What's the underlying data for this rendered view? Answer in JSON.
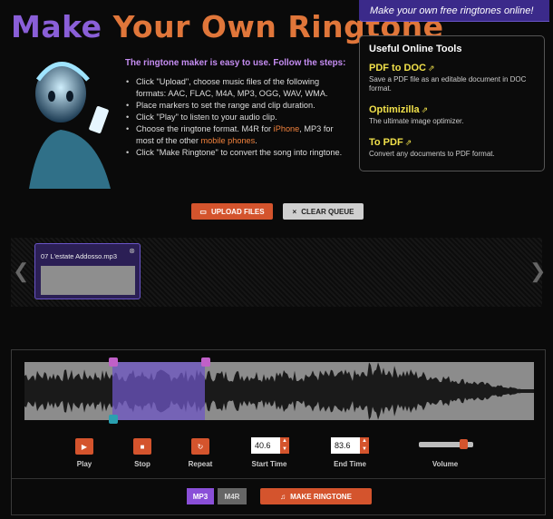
{
  "header": {
    "title_part1": "Make",
    "title_part2": "Your Own Ringtone",
    "banner": "Make your own free ringtones online!"
  },
  "intro": {
    "heading": "The ringtone maker is easy to use. Follow the steps:",
    "steps": [
      {
        "text": "Click \"Upload\", choose music files of the following formats: AAC, FLAC, M4A, MP3, OGG, WAV, WMA."
      },
      {
        "text": "Place markers to set the range and clip duration."
      },
      {
        "text": "Click \"Play\" to listen to your audio clip."
      },
      {
        "pre": "Choose the ringtone format. M4R for ",
        "hl1": "iPhone",
        "mid": ", MP3 for most of the other ",
        "hl2": "mobile phones",
        "post": "."
      },
      {
        "text": "Click \"Make Ringtone\" to convert the song into ringtone."
      }
    ]
  },
  "tools": {
    "heading": "Useful Online Tools",
    "items": [
      {
        "name": "PDF to DOC",
        "desc": "Save a PDF file as an editable document in DOC format."
      },
      {
        "name": "Optimizilla",
        "desc": "The ultimate image optimizer."
      },
      {
        "name": "To PDF",
        "desc": "Convert any documents to PDF format."
      }
    ]
  },
  "actions": {
    "upload": "UPLOAD FILES",
    "clear": "CLEAR QUEUE"
  },
  "queue": {
    "files": [
      {
        "name": "07 L'estate Addosso.mp3"
      }
    ]
  },
  "player": {
    "play": "Play",
    "stop": "Stop",
    "repeat": "Repeat",
    "start_label": "Start Time",
    "start_value": "40.6",
    "end_label": "End Time",
    "end_value": "83.6",
    "volume_label": "Volume",
    "volume_level": 0.8
  },
  "format": {
    "mp3": "MP3",
    "m4r": "M4R",
    "selected": "MP3",
    "make": "MAKE RINGTONE"
  },
  "colors": {
    "accent": "#d4542d",
    "purple": "#8a4fd8",
    "link": "#f0e04a"
  }
}
